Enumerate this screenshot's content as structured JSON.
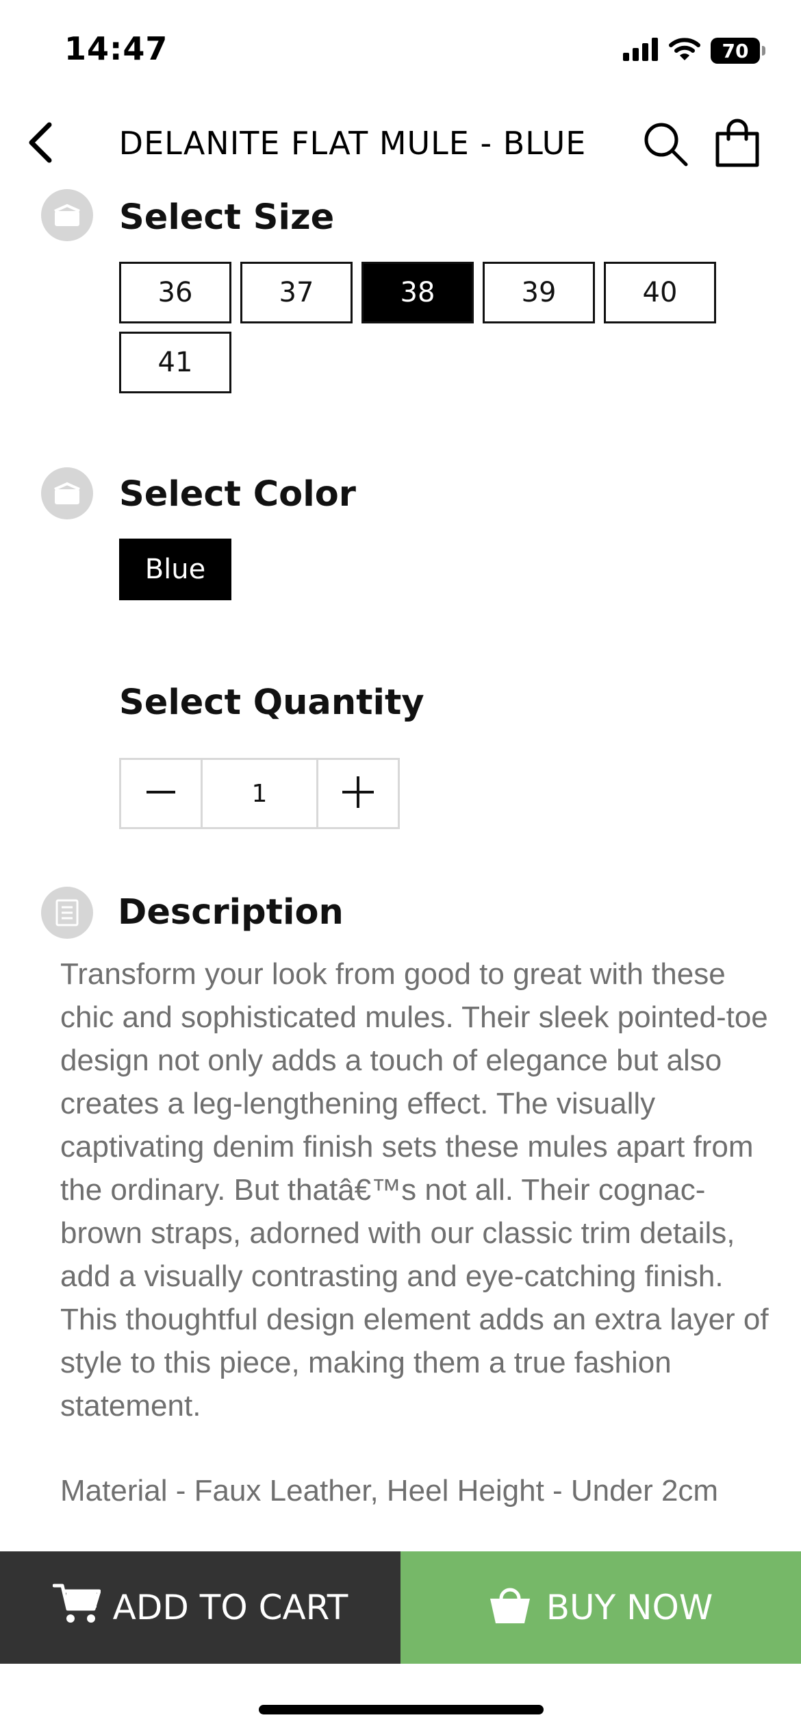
{
  "status_bar": {
    "time": "14:47",
    "battery": "70",
    "icons": [
      "signal-icon",
      "wifi-icon",
      "battery-icon"
    ]
  },
  "header": {
    "title": "DELANITE FLAT MULE - BLUE",
    "icons": [
      "back-arrow-icon",
      "search-icon",
      "shopping-bag-icon"
    ]
  },
  "size": {
    "title": "Select Size",
    "options": [
      "36",
      "37",
      "38",
      "39",
      "40",
      "41"
    ],
    "selected": "38"
  },
  "color": {
    "title": "Select Color",
    "options": [
      "Blue"
    ],
    "selected": "Blue"
  },
  "quantity": {
    "title": "Select Quantity",
    "value": "1"
  },
  "description": {
    "title": "Description",
    "body": "Transform your look from good to great with these chic and sophisticated mules. Their sleek pointed-toe design not only adds a touch of elegance but also creates a leg-lengthening effect. The visually captivating denim finish sets these mules apart from the ordinary. But thatâ€™s not all. Their cognac-brown straps, adorned with our classic trim details, add a visually contrasting and eye-catching finish. This thoughtful design element adds an extra layer of style to this piece, making them a true fashion statement.",
    "material": "Material - Faux Leather, Heel Height - Under 2cm"
  },
  "actions": {
    "add_to_cart": "ADD TO CART",
    "buy_now": "BUY NOW"
  },
  "colors": {
    "selected_bg": "#000000",
    "add_to_cart_bg": "#333333",
    "buy_now_bg": "#76b868",
    "section_icon_bg": "#d6d6d6",
    "description_text": "#6f6f6f"
  }
}
